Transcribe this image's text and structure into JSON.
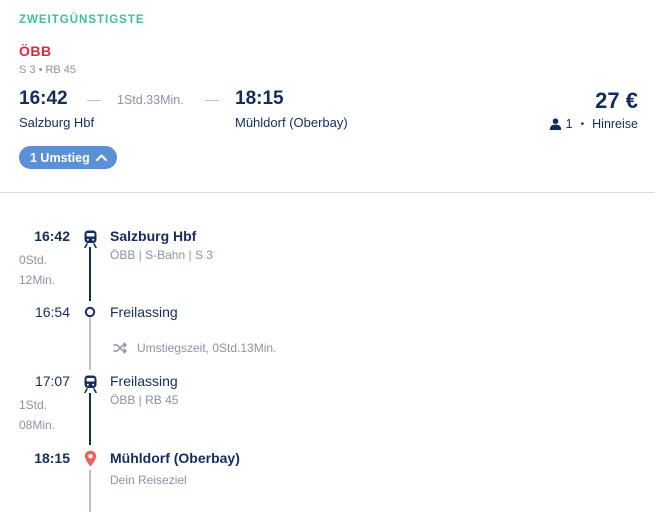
{
  "header": {
    "label": "ZWEITGÜNSTIGSTE"
  },
  "offer": {
    "operator": "ÖBB",
    "lines": "S 3 • RB 45",
    "departure_time": "16:42",
    "duration": "1Std.33Min.",
    "arrival_time": "18:15",
    "departure_station": "Salzburg Hbf",
    "arrival_station": "Mühldorf (Oberbay)",
    "price": "27 €",
    "passengers": "1",
    "trip_type": "Hinreise",
    "transfer_button": "1 Umstieg"
  },
  "timeline": {
    "stop1": {
      "time": "16:42",
      "name": "Salzburg Hbf",
      "sub": "ÖBB | S-Bahn | S 3",
      "duration_a": "0Std.",
      "duration_b": "12Min."
    },
    "stop2": {
      "time": "16:54",
      "name": "Freilassing"
    },
    "transfer": {
      "text": "Umstiegszeit, 0Std.13Min."
    },
    "stop3": {
      "time": "17:07",
      "name": "Freilassing",
      "sub": "ÖBB | RB 45",
      "duration_a": "1Std.",
      "duration_b": "08Min."
    },
    "stop4": {
      "time": "18:15",
      "name": "Mühldorf (Oberbay)",
      "sub": "Dein Reiseziel"
    }
  },
  "colors": {
    "accent_green": "#3fbf9a",
    "operator_red": "#e2263b",
    "navy": "#132d5c",
    "button_blue": "#5b8fd6",
    "destination_pin": "#f06060"
  },
  "icons": [
    "train-icon",
    "stop-circle-icon",
    "shuffle-icon",
    "location-pin-icon",
    "person-icon",
    "chevron-up-icon"
  ]
}
